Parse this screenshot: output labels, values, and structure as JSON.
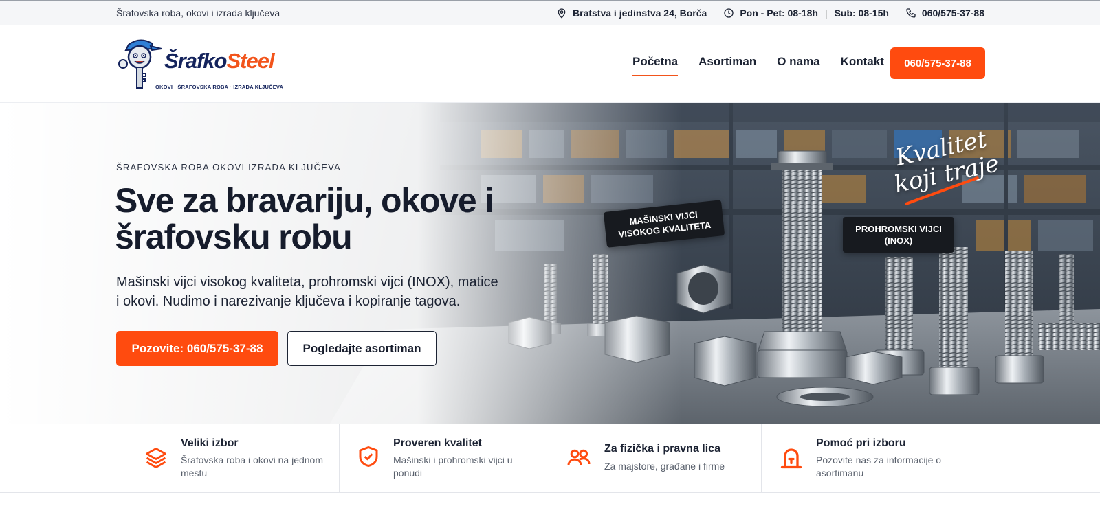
{
  "topbar": {
    "tagline": "Šrafovska roba, okovi i izrada ključeva",
    "address": "Bratstva i jedinstva 24, Borča",
    "hours_weekday": "Pon - Pet: 08-18h",
    "hours_separator": "|",
    "hours_saturday": "Sub: 08-15h",
    "phone": "060/575-37-88"
  },
  "header": {
    "logo": {
      "brand_part1": "Šrafko",
      "brand_part2": "Steel",
      "subtitle": "OKOVI · ŠRAFOVSKA ROBA · IZRADA KLJUČEVA"
    },
    "nav": [
      {
        "label": "Početna",
        "active": true
      },
      {
        "label": "Asortiman",
        "active": false
      },
      {
        "label": "O nama",
        "active": false
      },
      {
        "label": "Kontakt",
        "active": false
      }
    ],
    "cta_label": "060/575-37-88"
  },
  "hero": {
    "eyebrow": "ŠRAFOVSKA ROBA OKOVI IZRADA KLJUČEVA",
    "title": "Sve za bravariju, okove i šrafovsku robu",
    "lead": "Mašinski vijci visokog kvaliteta, prohromski vijci (INOX), matice i okovi. Nudimo i narezivanje ključeva i kopiranje tagova.",
    "primary_button": "Pozovite: 060/575-37-88",
    "secondary_button": "Pogledajte asortiman",
    "image_tags": {
      "tag1_line1": "MAŠINSKI VIJCI",
      "tag1_line2": "VISOKOG KVALITETA",
      "tag2_line1": "PROHROMSKI VIJCI",
      "tag2_line2": "(INOX)",
      "script_line1": "Kvalitet",
      "script_line2": "koji traje"
    }
  },
  "features": [
    {
      "icon": "layers-icon",
      "title": "Veliki izbor",
      "text": "Šrafovska roba i okovi na jednom mestu"
    },
    {
      "icon": "shield-check-icon",
      "title": "Proveren kvalitet",
      "text": "Mašinski i prohromski vijci u ponudi"
    },
    {
      "icon": "users-icon",
      "title": "Za fizička i pravna lica",
      "text": "Za majstore, građane i firme"
    },
    {
      "icon": "lock-icon",
      "title": "Pomoć pri izboru",
      "text": "Pozovite nas za informacije o asortimanu"
    }
  ],
  "colors": {
    "accent": "#ff4b0f",
    "navy": "#14235c",
    "text": "#1c2333"
  }
}
